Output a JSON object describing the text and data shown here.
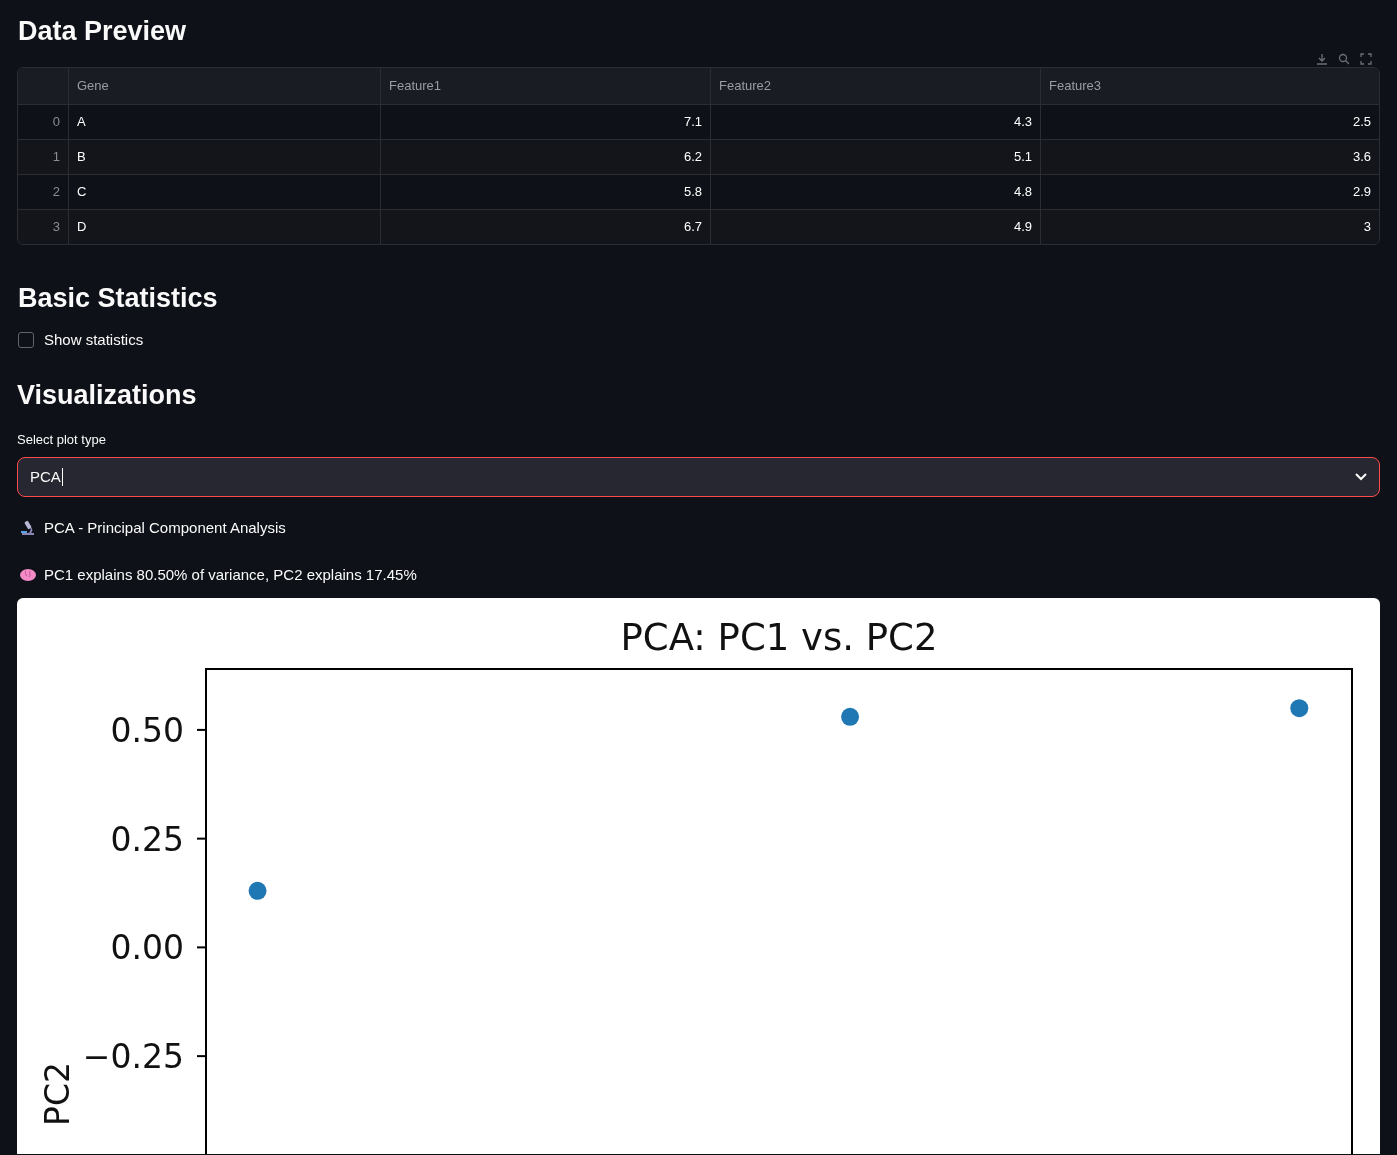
{
  "data_preview": {
    "title": "Data Preview",
    "columns": [
      "",
      "Gene",
      "Feature1",
      "Feature2",
      "Feature3"
    ],
    "rows": [
      [
        "0",
        "A",
        "7.1",
        "4.3",
        "2.5"
      ],
      [
        "1",
        "B",
        "6.2",
        "5.1",
        "3.6"
      ],
      [
        "2",
        "C",
        "5.8",
        "4.8",
        "2.9"
      ],
      [
        "3",
        "D",
        "6.7",
        "4.9",
        "3"
      ]
    ]
  },
  "basic_statistics": {
    "title": "Basic Statistics",
    "checkbox": {
      "label": "Show statistics",
      "checked": false
    }
  },
  "visualizations": {
    "title": "Visualizations",
    "select": {
      "label": "Select plot type",
      "value": "PCA",
      "focused": true
    },
    "messages": [
      {
        "kind": "microscope",
        "text": "PCA - Principal Component Analysis"
      },
      {
        "kind": "brain",
        "text": "PC1 explains 80.50% of variance, PC2 explains 17.45%"
      }
    ],
    "chart_data": {
      "type": "scatter",
      "title": "PCA: PC1 vs. PC2",
      "ylabel": "PC2",
      "ylim": [
        -0.475,
        0.64
      ],
      "yticks": [
        {
          "value": 0.5,
          "label": "0.50"
        },
        {
          "value": 0.25,
          "label": "0.25"
        },
        {
          "value": 0,
          "label": "0.00"
        },
        {
          "value": -0.25,
          "label": "−0.25"
        }
      ],
      "series": [
        {
          "color": "#1f77b4",
          "values": [
            0.13,
            0.53,
            0.55
          ]
        }
      ]
    }
  }
}
